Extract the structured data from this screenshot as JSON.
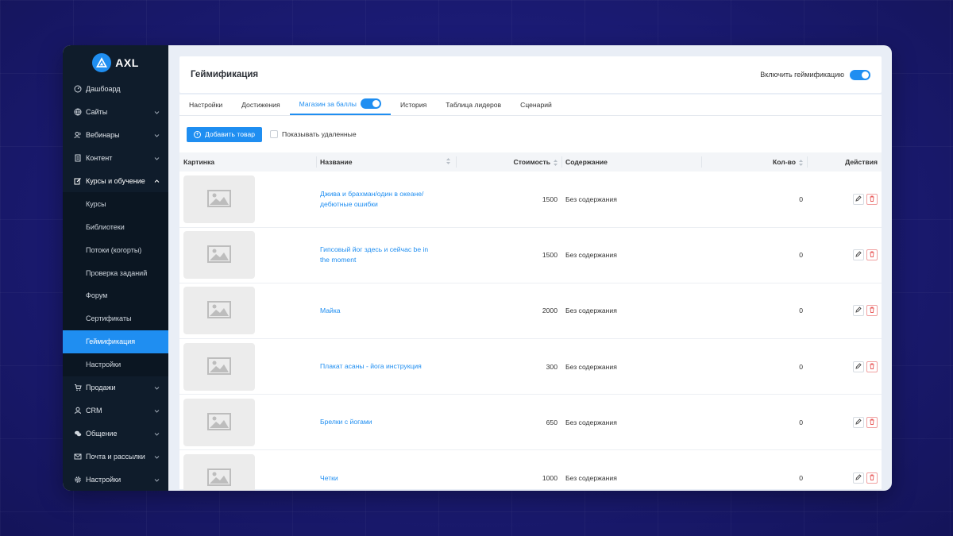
{
  "app": {
    "logo_text": "AXL"
  },
  "sidebar": {
    "items": [
      {
        "label": "Дашбоард",
        "icon": "dashboard-icon",
        "chevron": false
      },
      {
        "label": "Сайты",
        "icon": "globe-icon",
        "chevron": true
      },
      {
        "label": "Вебинары",
        "icon": "users-icon",
        "chevron": true
      },
      {
        "label": "Контент",
        "icon": "document-icon",
        "chevron": true
      },
      {
        "label": "Курсы и обучение",
        "icon": "edit-icon",
        "chevron": true,
        "open": true
      },
      {
        "label": "Продажи",
        "icon": "cart-icon",
        "chevron": true
      },
      {
        "label": "CRM",
        "icon": "user-icon",
        "chevron": true
      },
      {
        "label": "Общение",
        "icon": "chat-icon",
        "chevron": true
      },
      {
        "label": "Почта и рассылки",
        "icon": "mail-icon",
        "chevron": true
      },
      {
        "label": "Настройки",
        "icon": "gear-icon",
        "chevron": true
      }
    ],
    "subitems": [
      {
        "label": "Курсы"
      },
      {
        "label": "Библиотеки"
      },
      {
        "label": "Потоки (когорты)"
      },
      {
        "label": "Проверка заданий"
      },
      {
        "label": "Форум"
      },
      {
        "label": "Сертификаты"
      },
      {
        "label": "Геймификация",
        "active": true
      },
      {
        "label": "Настройки"
      }
    ]
  },
  "header": {
    "title": "Геймификация",
    "toggle_label": "Включить геймификацию",
    "toggle_on": true
  },
  "tabs": [
    {
      "label": "Настройки"
    },
    {
      "label": "Достижения"
    },
    {
      "label": "Магазин за баллы",
      "active": true,
      "toggle": true
    },
    {
      "label": "История"
    },
    {
      "label": "Таблица лидеров"
    },
    {
      "label": "Сценарий"
    }
  ],
  "toolbar": {
    "add_label": "Добавить товар",
    "show_deleted_label": "Показывать удаленные"
  },
  "table": {
    "columns": {
      "image": "Картинка",
      "name": "Название",
      "cost": "Стоимость",
      "content": "Содержание",
      "qty": "Кол-во",
      "actions": "Действия"
    },
    "rows": [
      {
        "name": "Джива и брахман/один в океане/ дебютные ошибки",
        "cost": "1500",
        "content": "Без содержания",
        "qty": "0"
      },
      {
        "name": "Гипсовый йог здесь и сейчас be in the moment",
        "cost": "1500",
        "content": "Без содержания",
        "qty": "0"
      },
      {
        "name": "Майка",
        "cost": "2000",
        "content": "Без содержания",
        "qty": "0"
      },
      {
        "name": "Плакат асаны - йога инструкция",
        "cost": "300",
        "content": "Без содержания",
        "qty": "0"
      },
      {
        "name": "Брелки с йогами",
        "cost": "650",
        "content": "Без содержания",
        "qty": "0"
      },
      {
        "name": "Четки",
        "cost": "1000",
        "content": "Без содержания",
        "qty": "0"
      }
    ]
  },
  "colors": {
    "accent": "#1f8ef1",
    "sidebar_bg": "#0f1c2b",
    "page_bg": "#1a1a6e",
    "delete": "#e85a5a"
  }
}
